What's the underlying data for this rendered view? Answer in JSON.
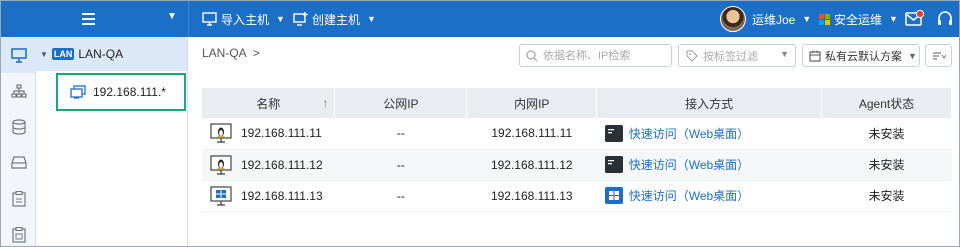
{
  "topbar": {
    "import_host": "导入主机",
    "create_host": "创建主机",
    "user": "运维Joe",
    "ops_menu": "安全运维",
    "brand_color": "#1c6fc6"
  },
  "tree": {
    "root_badge": "LAN",
    "root_label": "LAN-QA",
    "child_label": "192.168.111.*"
  },
  "main": {
    "breadcrumb": "LAN-QA",
    "breadcrumb_sep": ">",
    "search_placeholder": "依据名称、IP检索",
    "tag_filter": "按标签过滤",
    "plan": "私有云默认方案",
    "columns": [
      "名称",
      "公网IP",
      "内网IP",
      "接入方式",
      "Agent状态"
    ],
    "sort_indicator": "↑",
    "rows": [
      {
        "os": "linux-icon",
        "name": "192.168.111.11",
        "public_ip": "--",
        "private_ip": "192.168.111.11",
        "access": "快速访问（Web桌面）",
        "agent": "未安装"
      },
      {
        "os": "linux-icon",
        "name": "192.168.111.12",
        "public_ip": "--",
        "private_ip": "192.168.111.12",
        "access": "快速访问（Web桌面）",
        "agent": "未安装"
      },
      {
        "os": "windows-icon",
        "name": "192.168.111.13",
        "public_ip": "--",
        "private_ip": "192.168.111.13",
        "access": "快速访问（Web桌面）",
        "agent": "未安装"
      }
    ]
  }
}
